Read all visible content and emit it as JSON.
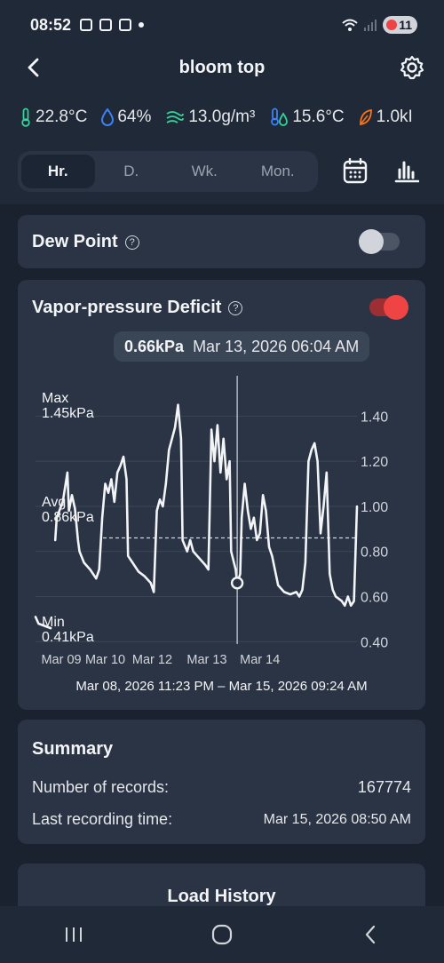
{
  "status": {
    "time": "08:52",
    "battery": "11"
  },
  "header": {
    "title": "bloom top"
  },
  "metrics": [
    {
      "icon": "thermometer-icon",
      "value": "22.8°C"
    },
    {
      "icon": "humidity-drop-icon",
      "value": "64%"
    },
    {
      "icon": "absolute-humidity-icon",
      "value": "13.0g/m³"
    },
    {
      "icon": "dew-point-icon",
      "value": "15.6°C"
    },
    {
      "icon": "vpd-leaf-icon",
      "value": "1.0kI"
    }
  ],
  "tabs": [
    "Hr.",
    "D.",
    "Wk.",
    "Mon."
  ],
  "active_tab": "Hr.",
  "dew_point": {
    "label": "Dew Point",
    "help": "?",
    "enabled": false
  },
  "vpd": {
    "label": "Vapor-pressure Deficit",
    "help": "?",
    "enabled": true,
    "tooltip_value": "0.66kPa",
    "tooltip_time": "Mar 13, 2026 06:04 AM",
    "max_label": "Max",
    "max_value": "1.45kPa",
    "avg_label": "Avg",
    "avg_value": "0.86kPa",
    "min_label": "Min",
    "min_value": "0.41kPa",
    "range": "Mar 08, 2026 11:23 PM – Mar 15, 2026 09:24 AM"
  },
  "chart_data": {
    "type": "line",
    "title": "Vapor-pressure Deficit",
    "x_ticks": [
      "Mar 09",
      "Mar 10",
      "Mar 12",
      "Mar 13",
      "Mar 14"
    ],
    "y_ticks": [
      "1.40",
      "1.20",
      "1.00",
      "0.80",
      "0.60",
      "0.40"
    ],
    "ylim": [
      0.35,
      1.5
    ],
    "xlim": [
      0,
      100
    ],
    "avg_line": 0.86,
    "cursor_x": 66.5,
    "cursor_y": 0.66,
    "series": [
      {
        "color": "#f3f4f6",
        "points": [
          [
            0,
            0.51
          ],
          [
            1,
            0.48
          ],
          [
            5,
            0.46
          ],
          [
            6.5,
            0.85
          ],
          [
            7,
            0.95
          ],
          [
            9,
            1.02
          ],
          [
            10.5,
            1.15
          ],
          [
            11,
            0.98
          ],
          [
            12,
            1.05
          ],
          [
            13,
            0.99
          ],
          [
            14,
            0.85
          ],
          [
            14.5,
            0.8
          ],
          [
            16,
            0.75
          ],
          [
            18,
            0.72
          ],
          [
            20,
            0.68
          ],
          [
            21,
            0.72
          ],
          [
            22,
            0.95
          ],
          [
            23,
            1.1
          ],
          [
            24,
            1.06
          ],
          [
            25,
            1.12
          ],
          [
            26,
            1.02
          ],
          [
            27,
            1.15
          ],
          [
            28,
            1.18
          ],
          [
            29,
            1.22
          ],
          [
            30,
            1.12
          ],
          [
            30.5,
            0.78
          ],
          [
            32,
            0.75
          ],
          [
            34,
            0.71
          ],
          [
            36,
            0.69
          ],
          [
            38,
            0.66
          ],
          [
            39,
            0.62
          ],
          [
            40,
            0.98
          ],
          [
            41,
            1.03
          ],
          [
            42,
            1.0
          ],
          [
            43,
            1.1
          ],
          [
            44,
            1.25
          ],
          [
            45,
            1.3
          ],
          [
            46,
            1.35
          ],
          [
            47,
            1.45
          ],
          [
            48,
            1.3
          ],
          [
            48.5,
            0.85
          ],
          [
            50,
            0.8
          ],
          [
            51,
            0.85
          ],
          [
            52,
            0.8
          ],
          [
            54,
            0.77
          ],
          [
            56,
            0.74
          ],
          [
            57,
            0.72
          ],
          [
            58,
            1.34
          ],
          [
            59,
            1.2
          ],
          [
            60,
            1.36
          ],
          [
            61,
            1.15
          ],
          [
            62,
            1.3
          ],
          [
            63,
            1.12
          ],
          [
            64,
            1.2
          ],
          [
            64.5,
            0.8
          ],
          [
            66,
            0.72
          ],
          [
            66.5,
            0.66
          ],
          [
            67.5,
            0.7
          ],
          [
            68,
            0.95
          ],
          [
            69,
            1.1
          ],
          [
            70,
            0.98
          ],
          [
            71,
            0.9
          ],
          [
            72,
            0.95
          ],
          [
            73,
            0.85
          ],
          [
            74,
            0.88
          ],
          [
            75,
            1.05
          ],
          [
            76,
            0.98
          ],
          [
            77,
            0.82
          ],
          [
            78,
            0.78
          ],
          [
            80,
            0.65
          ],
          [
            82,
            0.62
          ],
          [
            84,
            0.61
          ],
          [
            86,
            0.62
          ],
          [
            87,
            0.6
          ],
          [
            88,
            0.63
          ],
          [
            89,
            0.75
          ],
          [
            90,
            1.2
          ],
          [
            91,
            1.25
          ],
          [
            92,
            1.28
          ],
          [
            93,
            1.2
          ],
          [
            94,
            0.88
          ],
          [
            95,
            1.0
          ],
          [
            96,
            1.15
          ],
          [
            97,
            0.7
          ],
          [
            98,
            0.63
          ],
          [
            99,
            0.6
          ],
          [
            101,
            0.58
          ],
          [
            102,
            0.56
          ],
          [
            103,
            0.6
          ],
          [
            104,
            0.56
          ],
          [
            105,
            0.58
          ],
          [
            106,
            1.0
          ]
        ]
      }
    ]
  },
  "summary": {
    "title": "Summary",
    "records_label": "Number of records:",
    "records_value": "167774",
    "last_label": "Last recording time:",
    "last_value": "Mar 15, 2026 08:50 AM"
  },
  "load_history": "Load History"
}
